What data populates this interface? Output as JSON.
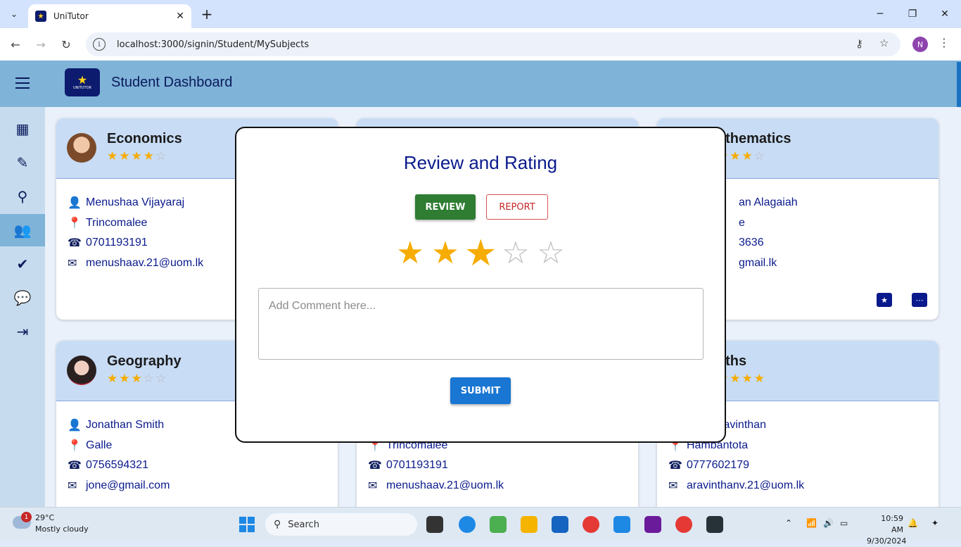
{
  "browser": {
    "tab_title": "UniTutor",
    "url": "localhost:3000/signin/Student/MySubjects",
    "profile_initial": "N"
  },
  "header": {
    "title": "Student Dashboard",
    "logo_text": "UNITUTOR"
  },
  "sidebar": {
    "items": [
      {
        "name": "dashboard",
        "icon": "dashboard-icon"
      },
      {
        "name": "edit",
        "icon": "pencil-icon"
      },
      {
        "name": "search",
        "icon": "search-icon"
      },
      {
        "name": "tutors",
        "icon": "group-icon",
        "active": true
      },
      {
        "name": "tasks",
        "icon": "add-task-icon"
      },
      {
        "name": "messages",
        "icon": "chat-icon"
      },
      {
        "name": "logout",
        "icon": "logout-icon"
      }
    ]
  },
  "cards": [
    {
      "subject": "Economics",
      "rating": 4,
      "tutor": "Menushaa Vijayaraj",
      "location": "Trincomalee",
      "phone": "0701193191",
      "email": "menushaav.21@uom.lk"
    },
    {
      "subject": "athematics",
      "rating": 3,
      "tutor": "an Alagaiah",
      "location": "e",
      "phone": "3636",
      "email": "gmail.lk"
    },
    {
      "subject": "Geography",
      "rating": 3,
      "tutor": "Jonathan Smith",
      "location": "Galle",
      "phone": "0756594321",
      "email": "jone@gmail.com"
    },
    {
      "subject": "",
      "rating": 0,
      "tutor": "",
      "location": "Trincomalee",
      "phone": "0701193191",
      "email": "menushaav.21@uom.lk"
    },
    {
      "subject": "aths",
      "rating": 5,
      "tutor": "ayini Aravinthan",
      "location": "Hambantota",
      "phone": "0777602179",
      "email": "aravinthanv.21@uom.lk"
    }
  ],
  "modal": {
    "title": "Review and Rating",
    "review_label": "REVIEW",
    "report_label": "REPORT",
    "rating": 3,
    "rating_max": 5,
    "comment_placeholder": "Add Comment here...",
    "submit_label": "SUBMIT"
  },
  "taskbar": {
    "weather_badge": "1",
    "temperature": "29°C",
    "condition": "Mostly cloudy",
    "search_label": "Search",
    "time": "10:59 AM",
    "date": "9/30/2024"
  }
}
